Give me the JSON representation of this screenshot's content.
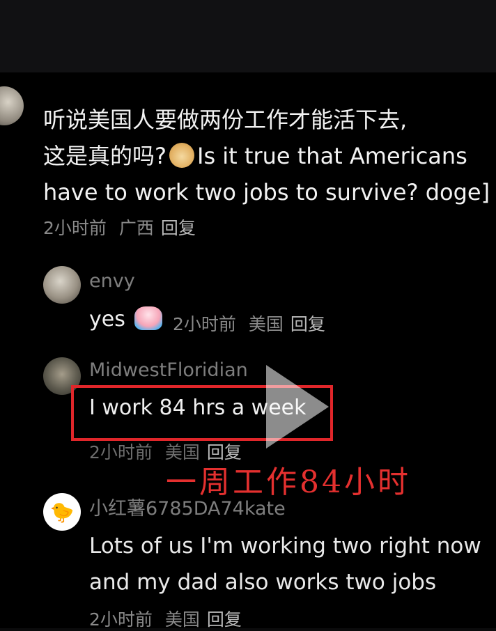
{
  "main_comment": {
    "line1": "听说美国人要做两份工作才能活下去,",
    "line2_prefix": "这是真的吗?",
    "line2_suffix": "Is it true that Americans",
    "line3": "have to work two jobs to survive? doge]",
    "time": "2小时前",
    "location": "广西",
    "reply": "回复"
  },
  "replies": [
    {
      "username": "envy",
      "text": "yes",
      "time": "2小时前",
      "location": "美国",
      "reply": "回复",
      "emoji": "crying-face-icon"
    },
    {
      "username": "MidwestFloridian",
      "text": "I work 84 hrs a week",
      "time": "2小时前",
      "location": "美国",
      "reply": "回复"
    },
    {
      "username": "小红薯6785DA74kate",
      "text_line1": "Lots of us I'm working two right now",
      "text_line2": "and my dad also works two jobs",
      "time": "2小时前",
      "location": "美国",
      "reply": "回复"
    }
  ],
  "annotation": "一周工作84小时",
  "colors": {
    "highlight": "#e0262a",
    "annotation": "#e4302f",
    "meta": "#8a8a8a",
    "background": "#000000"
  }
}
